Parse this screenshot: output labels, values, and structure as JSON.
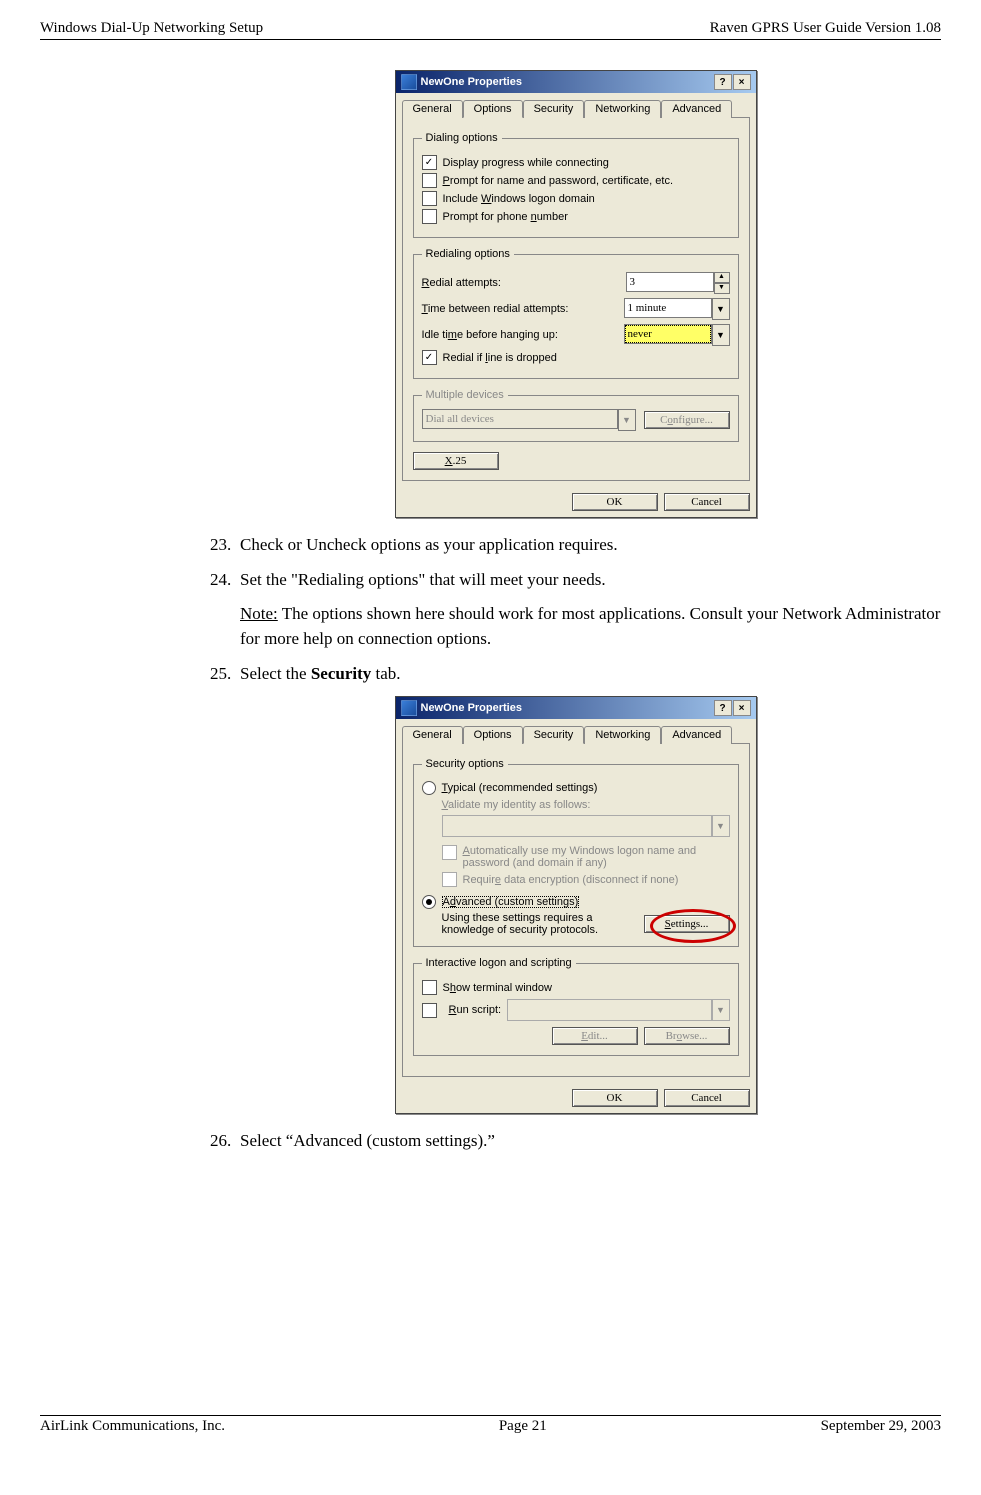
{
  "header": {
    "left": "Windows Dial-Up Networking Setup",
    "right": "Raven GPRS User Guide Version 1.08"
  },
  "footer": {
    "left": "AirLink Communications, Inc.",
    "center": "Page 21",
    "right": "September 29, 2003"
  },
  "dialog1": {
    "title": "NewOne Properties",
    "helpGlyph": "?",
    "closeGlyph": "×",
    "tabs": {
      "general": "General",
      "options": "Options",
      "security": "Security",
      "networking": "Networking",
      "advanced": "Advanced"
    },
    "dialing": {
      "legend": "Dialing options",
      "display": "Display progress while connecting",
      "prompt_pre": "Prompt for name and password, certificate, etc.",
      "include_pre": "Include ",
      "include_u": "W",
      "include_post": "indows logon domain",
      "phone_pre": "Prompt for phone ",
      "phone_u": "n",
      "phone_post": "umber"
    },
    "redial": {
      "legend": "Redialing options",
      "attempts_u": "R",
      "attempts_post": "edial attempts:",
      "attempts_val": "3",
      "time_u": "T",
      "time_post": "ime between redial attempts:",
      "time_val": "1 minute",
      "idle_pre": "Idle ti",
      "idle_u": "m",
      "idle_post": "e before hanging up:",
      "idle_val": "never",
      "drop_pre": "Redial if ",
      "drop_u": "l",
      "drop_post": "ine is dropped"
    },
    "multi": {
      "legend": "Multiple devices",
      "combo": "Dial all devices",
      "configure_pre": "C",
      "configure_u": "o",
      "configure_post": "nfigure..."
    },
    "x25_u": "X",
    "x25_post": ".25",
    "ok": "OK",
    "cancel": "Cancel"
  },
  "steps": {
    "s23_num": "23.",
    "s23": "Check or Uncheck options as your application requires.",
    "s24_num": "24.",
    "s24": "Set the \"Redialing options\" that will meet your needs.",
    "note_u": "Note:",
    "note_body": " The options shown here should work for most applications. Consult your Network Administrator for more help on connection options.",
    "s25_num": "25.",
    "s25_pre": "Select the ",
    "s25_bold": "Security",
    "s25_post": " tab.",
    "s26_num": "26.",
    "s26": "Select “Advanced (custom settings).”"
  },
  "dialog2": {
    "title": "NewOne Properties",
    "helpGlyph": "?",
    "closeGlyph": "×",
    "tabs": {
      "general": "General",
      "options": "Options",
      "security": "Security",
      "networking": "Networking",
      "advanced": "Advanced"
    },
    "secopts": {
      "legend": "Security options",
      "typical_u": "T",
      "typical_post": "ypical (recommended settings)",
      "validate_u": "V",
      "validate_post": "alidate my identity as follows:",
      "auto_u": "A",
      "auto_post": "utomatically use my Windows logon name and password (and domain if any)",
      "require_pre": "Requir",
      "require_u": "e",
      "require_post": " data encryption (disconnect if none)",
      "advanced_pre": "A",
      "advanced_u": "d",
      "advanced_post": "vanced (custom settings)",
      "advnote": "Using these settings requires a knowledge of security protocols.",
      "settings_u": "S",
      "settings_post": "ettings..."
    },
    "interactive": {
      "legend": "Interactive logon and scripting",
      "show_pre": "S",
      "show_u": "h",
      "show_post": "ow terminal window",
      "run_u": "R",
      "run_post": "un script:",
      "edit_u": "E",
      "edit_post": "dit...",
      "browse_pre": "Br",
      "browse_u": "o",
      "browse_post": "wse..."
    },
    "ok": "OK",
    "cancel": "Cancel"
  }
}
